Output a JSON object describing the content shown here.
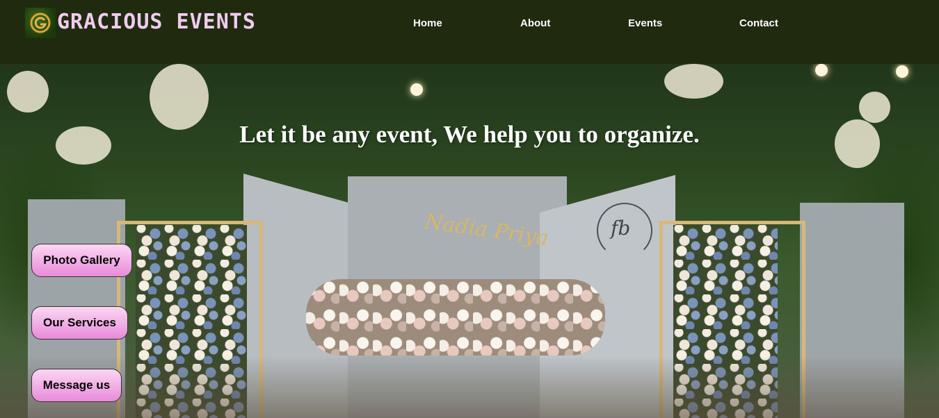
{
  "brand": {
    "name": "GRACIOUS EVENTS",
    "logo_icon": "g-logo-icon"
  },
  "nav": {
    "items": [
      "Home",
      "About",
      "Events",
      "Contact"
    ]
  },
  "hero": {
    "headline": "Let it be any event, We help you to organize.",
    "backdrop_text": "Nadia Priya",
    "florist_mark": "fb"
  },
  "side_buttons": [
    "Photo Gallery",
    "Our Services",
    "Message us"
  ],
  "colors": {
    "navbar_bg": "#1f2a0f",
    "brand_text": "#f0cdf0",
    "button_top": "#fbd7f3",
    "button_bottom": "#e98ad9"
  }
}
